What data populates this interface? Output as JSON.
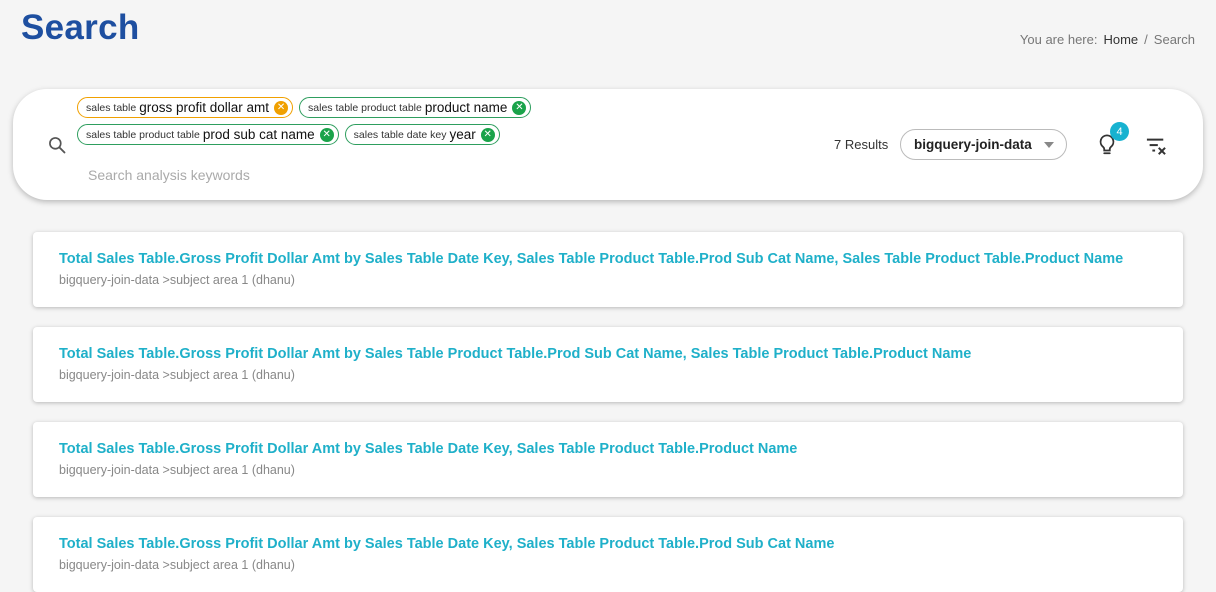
{
  "page": {
    "title": "Search",
    "breadcrumb": {
      "prefix": "You are here:",
      "home": "Home",
      "separator": "/",
      "current": "Search"
    }
  },
  "search": {
    "placeholder": "Search analysis keywords",
    "value": "",
    "chips": [
      {
        "context": "sales table",
        "value": "gross profit dollar amt",
        "status": "warning"
      },
      {
        "context": "sales table product table",
        "value": "product name",
        "status": "ok"
      },
      {
        "context": "sales table product table",
        "value": "prod sub cat name",
        "status": "ok"
      },
      {
        "context": "sales table date key",
        "value": "year",
        "status": "ok"
      }
    ],
    "results_count": "7 Results",
    "source": "bigquery-join-data",
    "hints_badge": "4"
  },
  "results": [
    {
      "title": "Total Sales Table.Gross Profit Dollar Amt by Sales Table Date Key, Sales Table Product Table.Prod Sub Cat Name, Sales Table Product Table.Product Name",
      "path": "bigquery-join-data >subject area 1 (dhanu)"
    },
    {
      "title": "Total Sales Table.Gross Profit Dollar Amt by Sales Table Product Table.Prod Sub Cat Name, Sales Table Product Table.Product Name",
      "path": "bigquery-join-data >subject area 1 (dhanu)"
    },
    {
      "title": "Total Sales Table.Gross Profit Dollar Amt by Sales Table Date Key, Sales Table Product Table.Product Name",
      "path": "bigquery-join-data >subject area 1 (dhanu)"
    },
    {
      "title": "Total Sales Table.Gross Profit Dollar Amt by Sales Table Date Key, Sales Table Product Table.Prod Sub Cat Name",
      "path": "bigquery-join-data >subject area 1 (dhanu)"
    }
  ],
  "colors": {
    "title": "#1e4fa0",
    "link": "#1fb0c9",
    "chip_ok": "#1aa34a",
    "chip_warning": "#f0a000",
    "badge": "#17b2d0"
  },
  "icons": [
    "search-icon",
    "close-circle-icon",
    "chevron-down-icon",
    "lightbulb-icon",
    "clear-filter-icon"
  ]
}
